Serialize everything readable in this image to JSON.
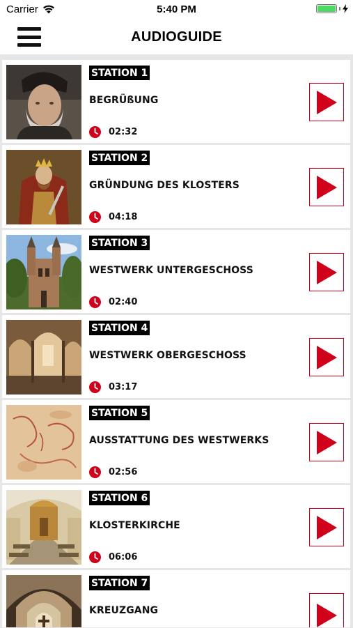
{
  "status_bar": {
    "carrier": "Carrier",
    "time": "5:40 PM",
    "wifi_icon": "wifi-icon",
    "battery_icon": "battery-icon",
    "charging_icon": "bolt-icon"
  },
  "nav": {
    "title": "AUDIOGUIDE",
    "menu_icon": "hamburger-menu-icon"
  },
  "colors": {
    "accent": "#d0021b",
    "badge_bg": "#000000",
    "separator": "#e6e6e6"
  },
  "stations": [
    {
      "badge": "STATION 1",
      "title": "BEGRÜßUNG",
      "duration": "02:32",
      "image": "portrait-of-man-with-fur-hat"
    },
    {
      "badge": "STATION 2",
      "title": "GRÜNDUNG DES KLOSTERS",
      "duration": "04:18",
      "image": "painting-of-crowned-king"
    },
    {
      "badge": "STATION 3",
      "title": "WESTWERK UNTERGESCHOSS",
      "duration": "02:40",
      "image": "church-westwork-exterior"
    },
    {
      "badge": "STATION 4",
      "title": "WESTWERK OBERGESCHOSS",
      "duration": "03:17",
      "image": "arched-hall-interior"
    },
    {
      "badge": "STATION 5",
      "title": "AUSSTATTUNG DES WESTWERKS",
      "duration": "02:56",
      "image": "wall-painting-fragment"
    },
    {
      "badge": "STATION 6",
      "title": "KLOSTERKIRCHE",
      "duration": "06:06",
      "image": "baroque-church-interior"
    },
    {
      "badge": "STATION 7",
      "title": "KREUZGANG",
      "duration": "",
      "image": "cloister-corridor"
    }
  ]
}
